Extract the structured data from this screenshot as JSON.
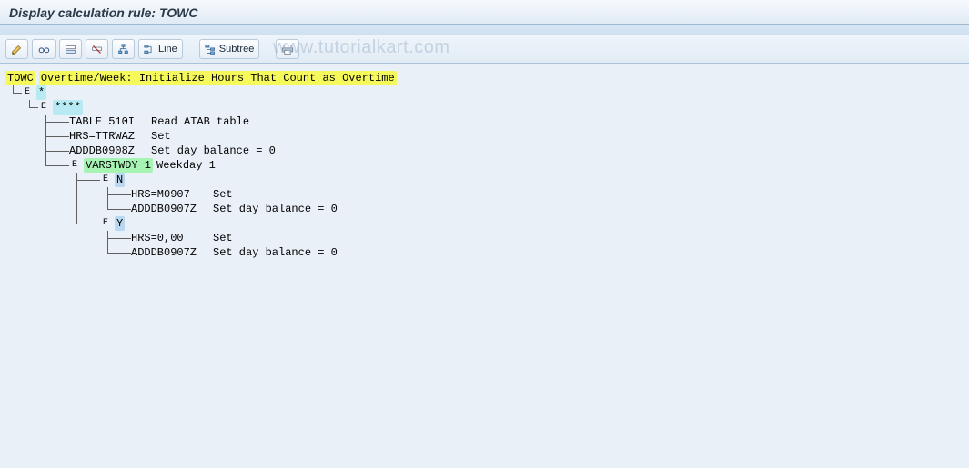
{
  "title": "Display calculation rule: TOWC",
  "toolbar": {
    "line_label": "Line",
    "subtree_label": "Subtree"
  },
  "watermark": "www.tutorialkart.com",
  "tree": {
    "root_code": "TOWC",
    "root_desc": "Overtime/Week: Initialize Hours That Count as Overtime",
    "lvl1_code": "*",
    "lvl2_code": "****",
    "leaf_a_key": "TABLE 510I",
    "leaf_a_desc": "Read ATAB table",
    "leaf_b_key": "HRS=TTRWAZ",
    "leaf_b_desc": "Set",
    "leaf_c_key": "ADDDB0908Z",
    "leaf_c_desc": "Set day balance = 0",
    "lvl3_code": "VARSTWDY 1",
    "lvl3_desc": "Weekday 1",
    "branch_n_code": "N",
    "n_leaf1_key": "HRS=M0907",
    "n_leaf1_desc": "Set",
    "n_leaf2_key": "ADDDB0907Z",
    "n_leaf2_desc": "Set day balance = 0",
    "branch_y_code": "Y",
    "y_leaf1_key": "HRS=0,00",
    "y_leaf1_desc": "Set",
    "y_leaf2_key": "ADDDB0907Z",
    "y_leaf2_desc": "Set day balance = 0"
  }
}
